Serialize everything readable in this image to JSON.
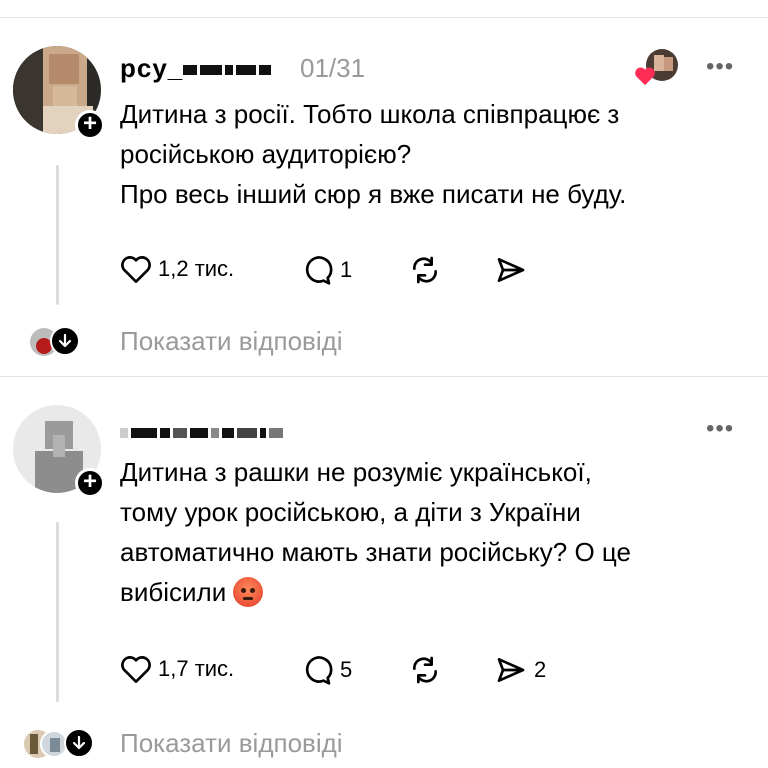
{
  "posts": [
    {
      "username": "рсу_",
      "date": "01/31",
      "text_lines": [
        "Дитина з росії. Тобто школа співпрацює з",
        "російською аудиторією?",
        "Про весь інший сюр я вже писати не буду."
      ],
      "likes": "1,2 тис.",
      "comments": "1",
      "reposts": "",
      "shares": "",
      "show_replies": "Показати відповіді"
    },
    {
      "username": "",
      "date": "",
      "text_lines": [
        "Дитина з рашки не розуміє української,",
        "тому урок російською, а діти з України",
        "автоматично мають знати російську? О це",
        "вибісили"
      ],
      "likes": "1,7 тис.",
      "comments": "5",
      "reposts": "",
      "shares": "2",
      "show_replies": "Показати відповіді"
    }
  ],
  "icons": {
    "like": "heart-outline-icon",
    "comment": "comment-bubble-icon",
    "repost": "repost-arrows-icon",
    "share": "send-arrow-icon",
    "more": "more-dots-icon",
    "follow": "plus-icon",
    "expand": "arrow-down-icon",
    "liked_by_author": "heart-filled-icon",
    "angry_emoji": "angry-face-emoji"
  },
  "colors": {
    "text": "#000000",
    "muted": "#999999",
    "divider": "#e2e2e2",
    "heart": "#ff2d55"
  }
}
